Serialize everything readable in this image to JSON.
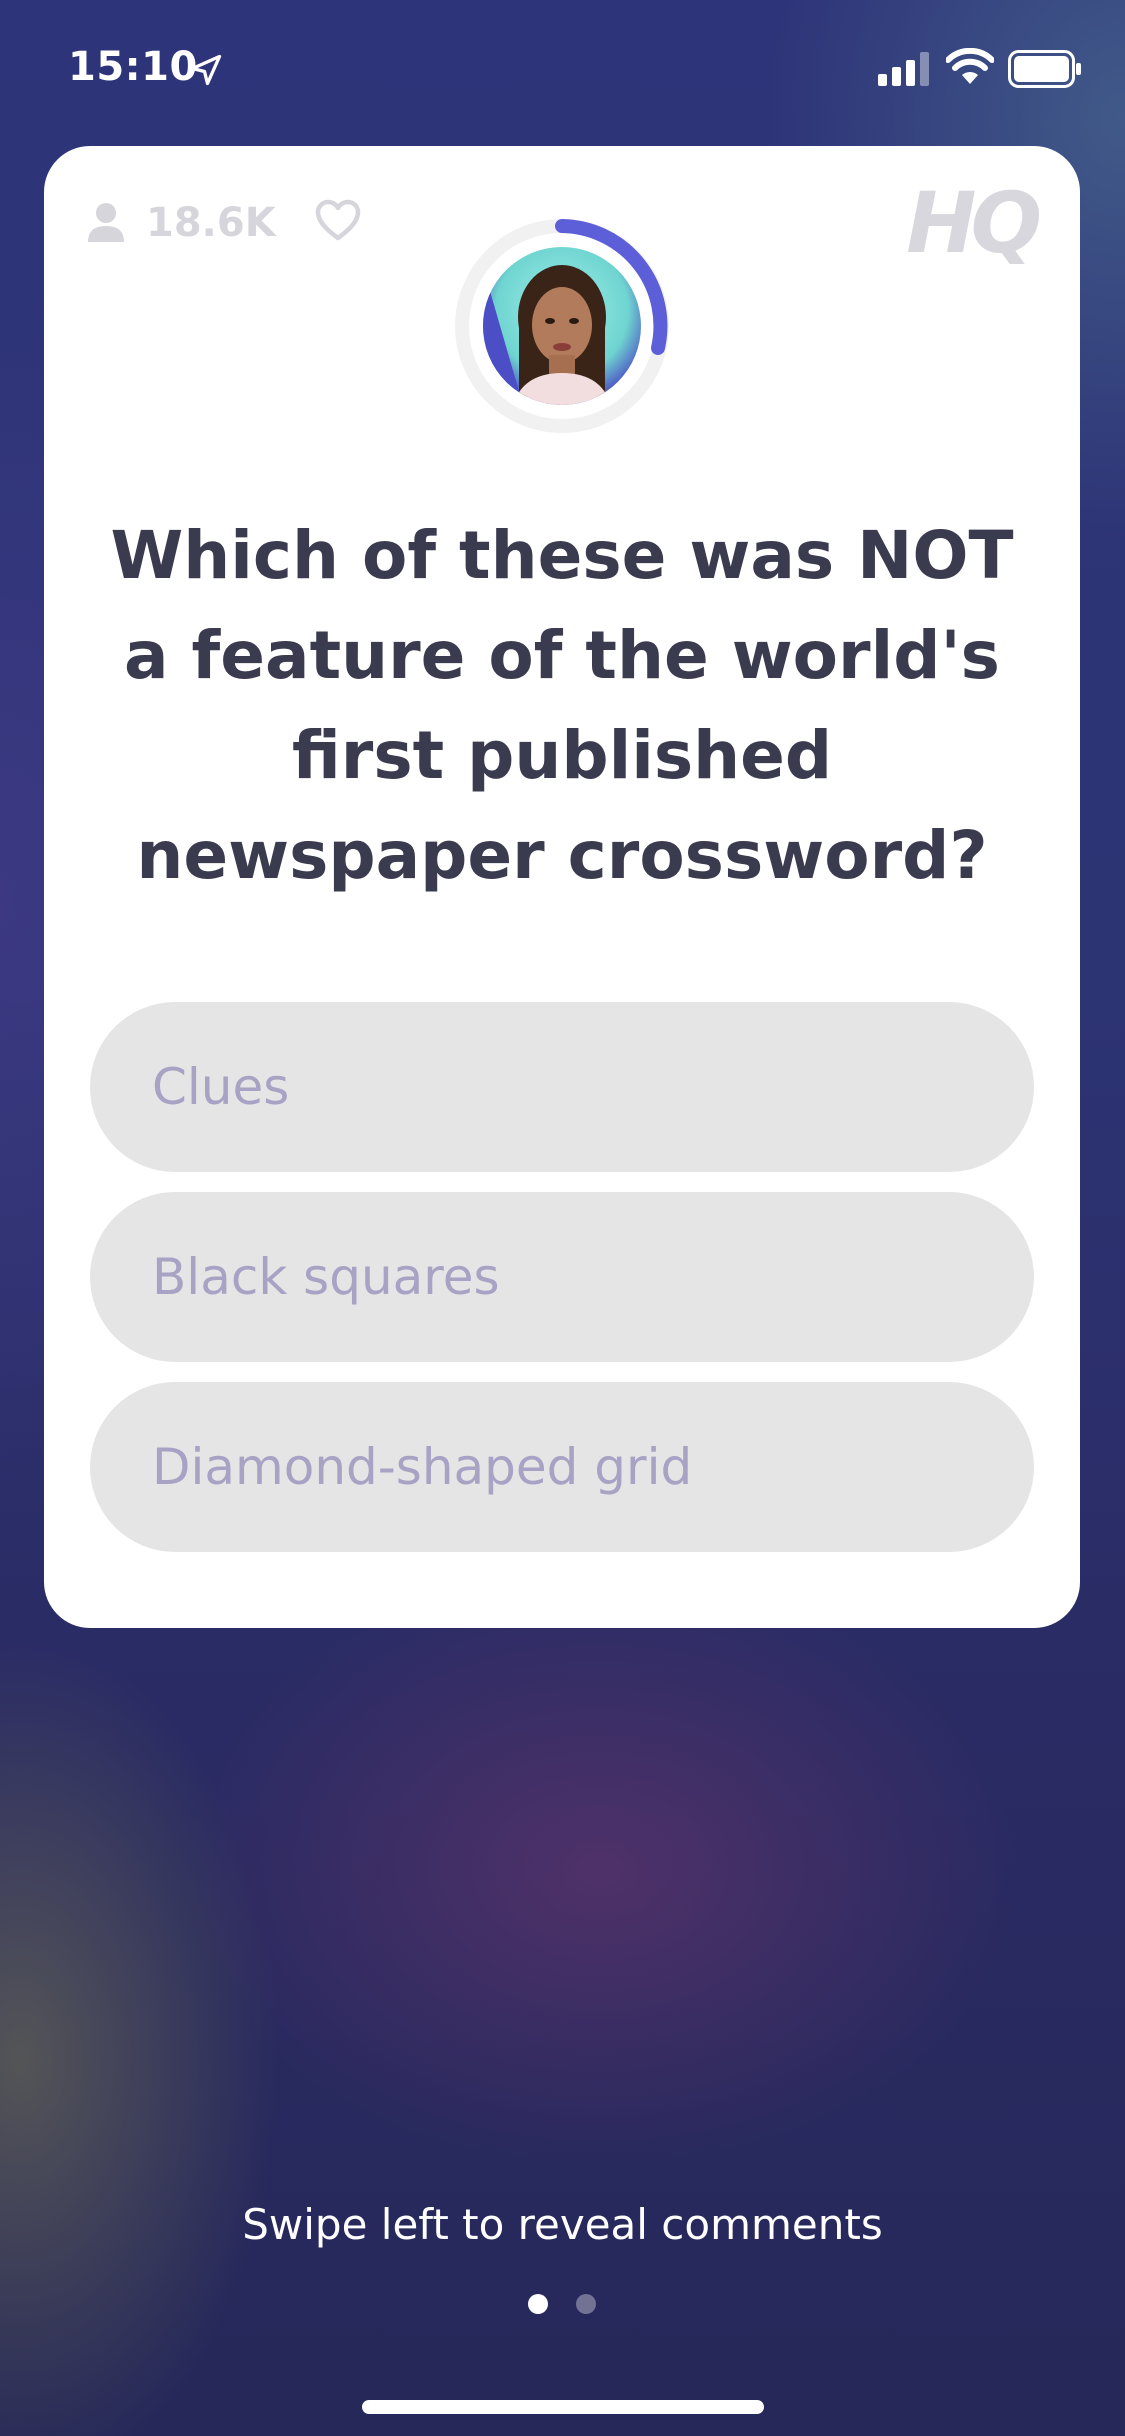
{
  "status_bar": {
    "time": "15:10"
  },
  "header": {
    "viewer_count": "18.6K",
    "logo_text": "HQ"
  },
  "question": {
    "text": "Which of these was NOT a feature of the world's first published newspaper crossword?"
  },
  "answers": [
    {
      "label": "Clues"
    },
    {
      "label": "Black squares"
    },
    {
      "label": "Diamond-shaped grid"
    }
  ],
  "footer": {
    "swipe_hint": "Swipe left to reveal comments",
    "page_count": 2,
    "active_page": 1
  },
  "colors": {
    "accent": "#5c5fd8",
    "card_bg": "#ffffff",
    "answer_bg": "#e5e5e5",
    "answer_text": "#a8a2c4",
    "question_text": "#3b3b4f"
  },
  "timer": {
    "progress_fraction": 0.3
  }
}
